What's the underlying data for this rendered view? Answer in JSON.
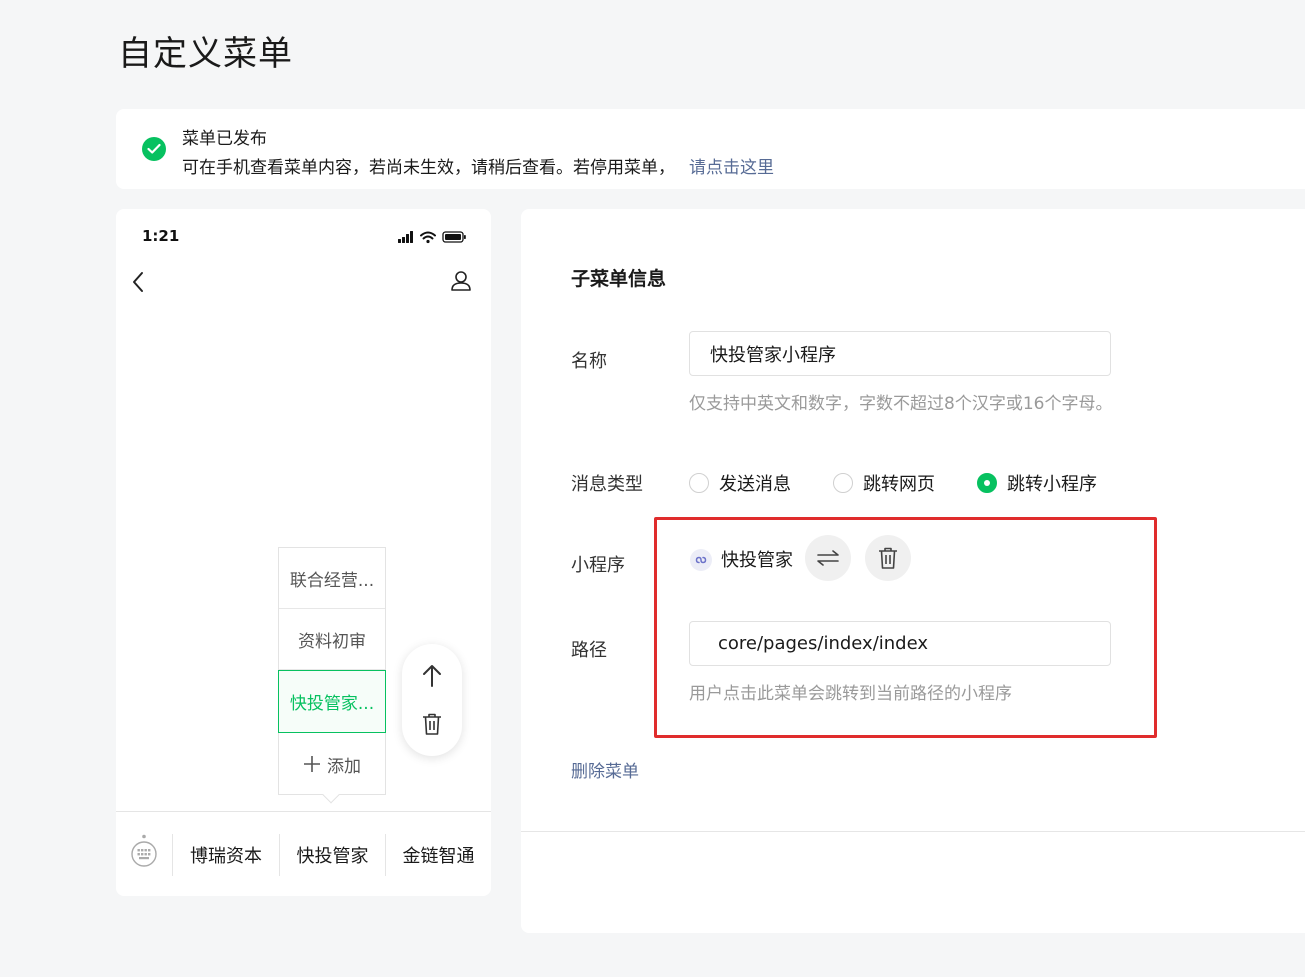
{
  "page": {
    "title": "自定义菜单"
  },
  "notice": {
    "title": "菜单已发布",
    "description": "可在手机查看菜单内容，若尚未生效，请稍后查看。若停用菜单，",
    "link": "请点击这里"
  },
  "phone": {
    "time": "1:21",
    "submenu": {
      "items": [
        {
          "label": "联合经营..."
        },
        {
          "label": "资料初审"
        },
        {
          "label": "快投管家..."
        }
      ],
      "add_label": "添加"
    },
    "bottom_menu": [
      "博瑞资本",
      "快投管家",
      "金链智通"
    ]
  },
  "panel": {
    "section_title": "子菜单信息",
    "name": {
      "label": "名称",
      "value": "快投管家小程序",
      "hint": "仅支持中英文和数字，字数不超过8个汉字或16个字母。"
    },
    "message_type": {
      "label": "消息类型",
      "options": [
        "发送消息",
        "跳转网页",
        "跳转小程序"
      ],
      "selected": "跳转小程序"
    },
    "mini_program": {
      "label": "小程序",
      "name": "快投管家"
    },
    "path": {
      "label": "路径",
      "value": "core/pages/index/index",
      "hint": "用户点击此菜单会跳转到当前路径的小程序"
    },
    "delete_label": "删除菜单"
  },
  "colors": {
    "accent": "#07c160",
    "link": "#576b95",
    "highlight_box": "#e02c2c"
  }
}
